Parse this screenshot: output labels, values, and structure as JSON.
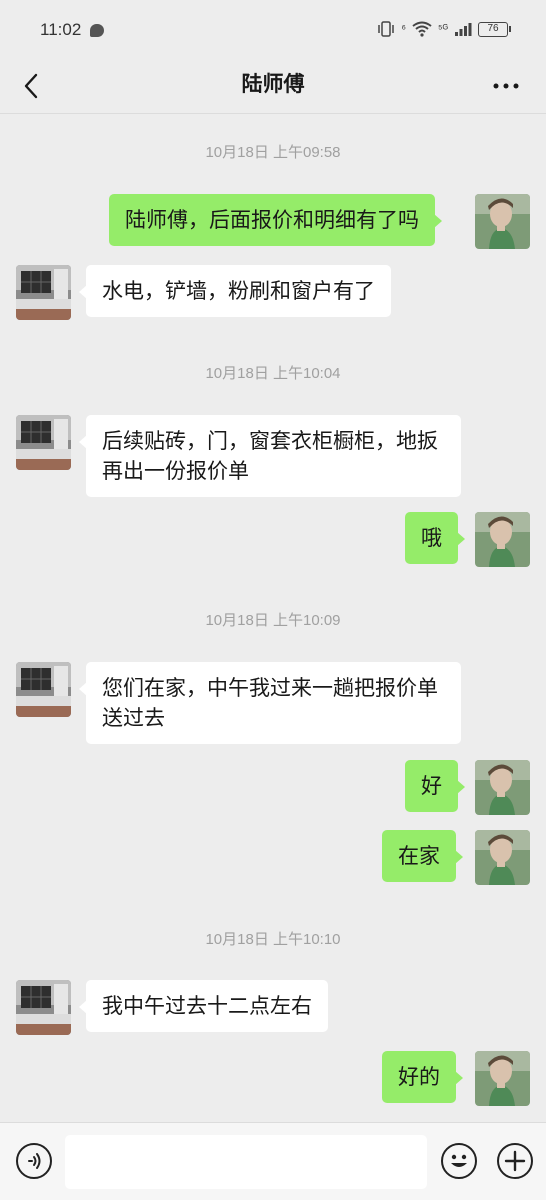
{
  "status_bar": {
    "time": "11:02",
    "network_a": "⁶",
    "network_b": "⁵ᴳ",
    "battery": "76"
  },
  "header": {
    "title": "陆师傅"
  },
  "messages": [
    {
      "kind": "timestamp",
      "text": "10月18日 上午09:58"
    },
    {
      "kind": "sent",
      "text": "陆师傅，后面报价和明细有了吗"
    },
    {
      "kind": "received",
      "text": "水电，铲墙，粉刷和窗户有了"
    },
    {
      "kind": "timestamp",
      "text": "10月18日 上午10:04"
    },
    {
      "kind": "received",
      "text": "后续贴砖，门，窗套衣柜橱柜，地扳再出一份报价单"
    },
    {
      "kind": "sent",
      "text": "哦"
    },
    {
      "kind": "timestamp",
      "text": "10月18日 上午10:09"
    },
    {
      "kind": "received",
      "text": "您们在家，中午我过来一趟把报价单送过去"
    },
    {
      "kind": "sent",
      "text": "好"
    },
    {
      "kind": "sent",
      "text": "在家"
    },
    {
      "kind": "timestamp",
      "text": "10月18日 上午10:10"
    },
    {
      "kind": "received",
      "text": "我中午过去十二点左右"
    },
    {
      "kind": "sent",
      "text": "好的"
    }
  ],
  "colors": {
    "background": "#ededed",
    "sent_bubble": "#95ec69",
    "received_bubble": "#ffffff",
    "timestamp_text": "#a0a0a0"
  },
  "icons": {
    "back": "chevron-left-icon",
    "more": "more-dots-icon",
    "voice": "voice-icon",
    "emoji": "emoji-icon",
    "plus": "plus-icon"
  },
  "input": {
    "value": "",
    "placeholder": ""
  }
}
